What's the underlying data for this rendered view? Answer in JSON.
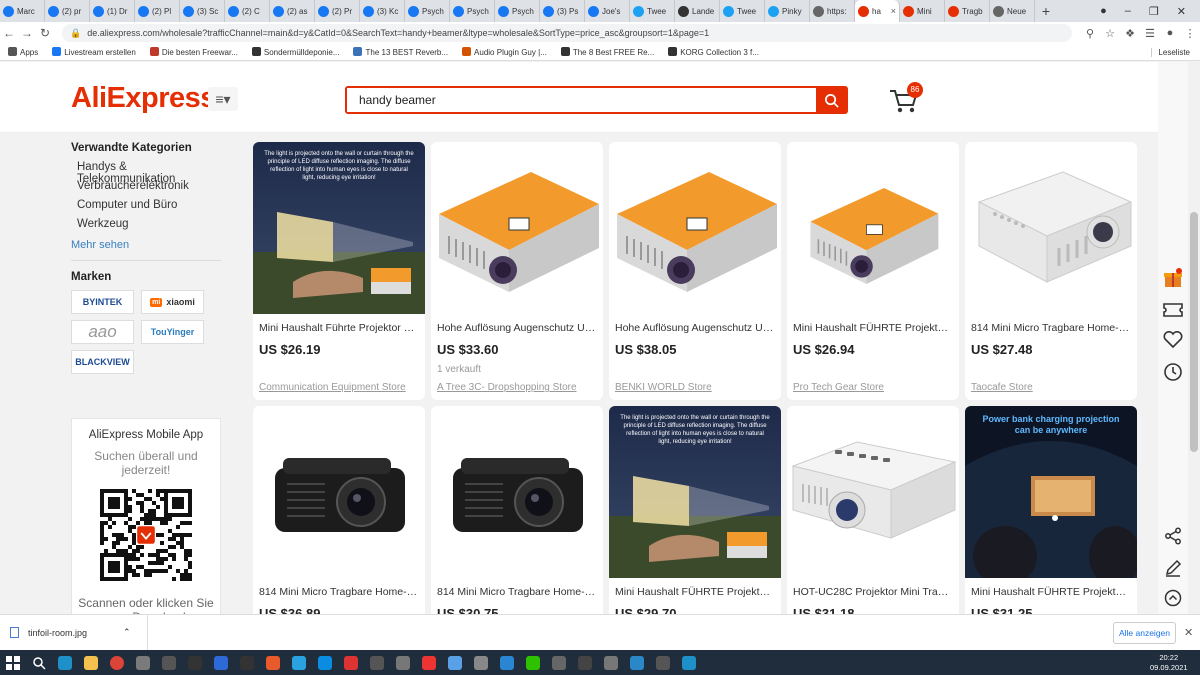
{
  "browser": {
    "tabs": [
      {
        "label": "Marc",
        "icon": "facebook-icon",
        "color": "#1877f2"
      },
      {
        "label": "(2) pr",
        "icon": "facebook-icon",
        "color": "#1877f2"
      },
      {
        "label": "(1) Dr",
        "icon": "facebook-icon",
        "color": "#1877f2"
      },
      {
        "label": "(2) Pl",
        "icon": "facebook-icon",
        "color": "#1877f2"
      },
      {
        "label": "(3) Sc",
        "icon": "facebook-icon",
        "color": "#1877f2"
      },
      {
        "label": "(2) C",
        "icon": "facebook-icon",
        "color": "#1877f2"
      },
      {
        "label": "(2) as",
        "icon": "facebook-icon",
        "color": "#1877f2"
      },
      {
        "label": "(2) Pr",
        "icon": "facebook-icon",
        "color": "#1877f2"
      },
      {
        "label": "(3) Kc",
        "icon": "facebook-icon",
        "color": "#1877f2"
      },
      {
        "label": "Psych",
        "icon": "facebook-icon",
        "color": "#1877f2"
      },
      {
        "label": "Psych",
        "icon": "facebook-icon",
        "color": "#1877f2"
      },
      {
        "label": "Psych",
        "icon": "facebook-icon",
        "color": "#1877f2"
      },
      {
        "label": "(3) Ps",
        "icon": "facebook-icon",
        "color": "#1877f2"
      },
      {
        "label": "Joe's",
        "icon": "facebook-icon",
        "color": "#1877f2"
      },
      {
        "label": "Twee",
        "icon": "twitter-icon",
        "color": "#1da1f2"
      },
      {
        "label": "Lande",
        "icon": "x-circle-icon",
        "color": "#333333"
      },
      {
        "label": "Twee",
        "icon": "twitter-icon",
        "color": "#1da1f2"
      },
      {
        "label": "Pinky",
        "icon": "twitter-icon",
        "color": "#1da1f2"
      },
      {
        "label": "https:",
        "icon": "globe-icon",
        "color": "#666666"
      },
      {
        "label": "ha",
        "icon": "aliexpress-icon",
        "color": "#e62e04",
        "active": true
      },
      {
        "label": "Mini",
        "icon": "aliexpress-icon",
        "color": "#e62e04"
      },
      {
        "label": "Tragb",
        "icon": "aliexpress-icon",
        "color": "#e62e04"
      },
      {
        "label": "Neue",
        "icon": "globe-icon",
        "color": "#666666"
      }
    ],
    "url": "de.aliexpress.com/wholesale?trafficChannel=main&d=y&CatId=0&SearchText=handy+beamer&ltype=wholesale&SortType=price_asc&groupsort=1&page=1",
    "bookmarks": [
      {
        "label": "Apps",
        "icon": "apps-grid-icon",
        "color": "#555555"
      },
      {
        "label": "Livestream erstellen",
        "icon": "facebook-icon",
        "color": "#1877f2"
      },
      {
        "label": "Die besten Freewar...",
        "icon": "star-icon",
        "color": "#c0392b"
      },
      {
        "label": "Sondermülldeponie...",
        "icon": "w-icon",
        "color": "#333333"
      },
      {
        "label": "The 13 BEST Reverb...",
        "icon": "bookmark-icon",
        "color": "#3b73b9"
      },
      {
        "label": "Audio Plugin Guy |...",
        "icon": "bookmark-icon",
        "color": "#d35400"
      },
      {
        "label": "The 8 Best FREE Re...",
        "icon": "bookmark-icon",
        "color": "#333333"
      },
      {
        "label": "KORG Collection 3 f...",
        "icon": "korg-icon",
        "color": "#333333"
      }
    ],
    "reading_list": "Leseliste"
  },
  "header": {
    "logo": "AliExpress",
    "search_value": "handy beamer",
    "cart_count": "86"
  },
  "sidebar": {
    "related_title": "Verwandte Kategorien",
    "categories": [
      "Handys & Telekommunikation",
      "Verbraucherelektronik",
      "Computer und Büro",
      "Werkzeug"
    ],
    "more": "Mehr sehen",
    "brands_title": "Marken",
    "brands": [
      "BYINTEK",
      "xiaomi",
      "aao",
      "TouYinger",
      "BLACKVIEW"
    ]
  },
  "app_promo": {
    "title": "AliExpress Mobile App",
    "subtitle": "Suchen überall und jederzeit!",
    "bottom": "Scannen oder klicken Sie zum Download"
  },
  "products": [
    {
      "title": "Mini Haushalt Führte Projektor Us...",
      "price": "US $26.19",
      "sold": "",
      "store": "Communication Equipment Store",
      "img": "photo-outdoor",
      "img_text": "The light is projected onto the wall or curtain through the principle of LED diffuse reflection imaging. The diffuse reflection of light into human eyes is close to natural light, reducing eye irritation!"
    },
    {
      "title": "Hohe Auflösung Augenschutz Uc2...",
      "price": "US $33.60",
      "sold": "1 verkauft",
      "store": "A Tree 3C- Dropshopping Store",
      "img": "orange-projector",
      "img_text": ""
    },
    {
      "title": "Hohe Auflösung Augenschutz Uc2...",
      "price": "US $38.05",
      "sold": "",
      "store": "BENKI WORLD Store",
      "img": "orange-projector",
      "img_text": ""
    },
    {
      "title": "Mini Haushalt FÜHRTE Projektor U...",
      "price": "US $26.94",
      "sold": "",
      "store": "Pro Tech Gear Store",
      "img": "orange-small",
      "img_text": ""
    },
    {
      "title": "814 Mini Micro Tragbare Home-En...",
      "price": "US $27.48",
      "sold": "",
      "store": "Taocafe Store",
      "img": "white-projector",
      "img_text": ""
    },
    {
      "title": "814 Mini Micro Tragbare Home-En...",
      "price": "US $36.89",
      "sold": "",
      "store": "",
      "img": "black-projector",
      "img_text": ""
    },
    {
      "title": "814 Mini Micro Tragbare Home-En...",
      "price": "US $30.75",
      "sold": "",
      "store": "",
      "img": "black-projector",
      "img_text": ""
    },
    {
      "title": "Mini Haushalt FÜHRTE Projektor U...",
      "price": "US $29.70",
      "sold": "",
      "store": "",
      "img": "photo-outdoor",
      "img_text": "The light is projected onto the wall or curtain through the principle of LED diffuse reflection imaging. The diffuse reflection of light into human eyes is close to natural light, reducing eye irritation!"
    },
    {
      "title": "HOT-UC28C Projektor Mini Tragba...",
      "price": "US $31.18",
      "sold": "",
      "store": "",
      "img": "white-uc28",
      "img_text": ""
    },
    {
      "title": "Mini Haushalt FÜHRTE Projektor U...",
      "price": "US $31.25",
      "sold": "",
      "store": "",
      "img": "photo-car",
      "img_text": "Power bank charging projection can be anywhere"
    }
  ],
  "download_bar": {
    "file": "tinfoil-room.jpg",
    "show_all": "Alle anzeigen"
  },
  "taskbar": {
    "time": "20:22",
    "date": "09.09.2021"
  }
}
